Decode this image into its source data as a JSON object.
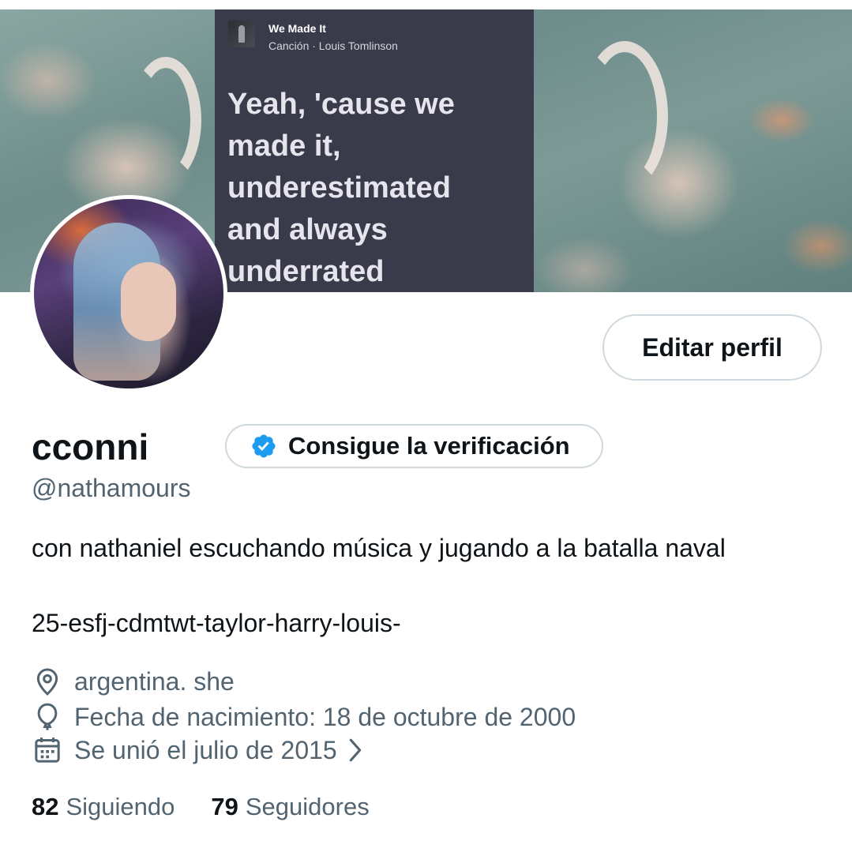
{
  "banner": {
    "song_title": "We Made It",
    "song_meta": "Canción · Louis Tomlinson",
    "lyrics": "Yeah, 'cause we\nmade it,\nunderestimated\nand always\nunderrated"
  },
  "profile": {
    "edit_label": "Editar perfil",
    "display_name": "cconni",
    "verify_label": "Consigue la verificación",
    "handle": "@nathamours",
    "bio_line_1": "con nathaniel escuchando música y jugando a la batalla naval",
    "bio_line_2": "25-esfj-cdmtwt-taylor-harry-louis-",
    "location": "argentina. she",
    "birthday": "Fecha de nacimiento: 18 de octubre de 2000",
    "joined": "Se unió el julio de 2015",
    "following_count": "82",
    "following_label": "Siguiendo",
    "followers_count": "79",
    "followers_label": "Seguidores"
  },
  "icons": {
    "verify": "verified-badge-icon",
    "location": "location-pin-icon",
    "birthday": "balloon-icon",
    "joined": "calendar-icon",
    "chevron": "chevron-right-icon"
  },
  "colors": {
    "text_primary": "#0f1419",
    "text_secondary": "#536471",
    "border": "#cfd9de",
    "verified_blue": "#1d9bf0"
  }
}
